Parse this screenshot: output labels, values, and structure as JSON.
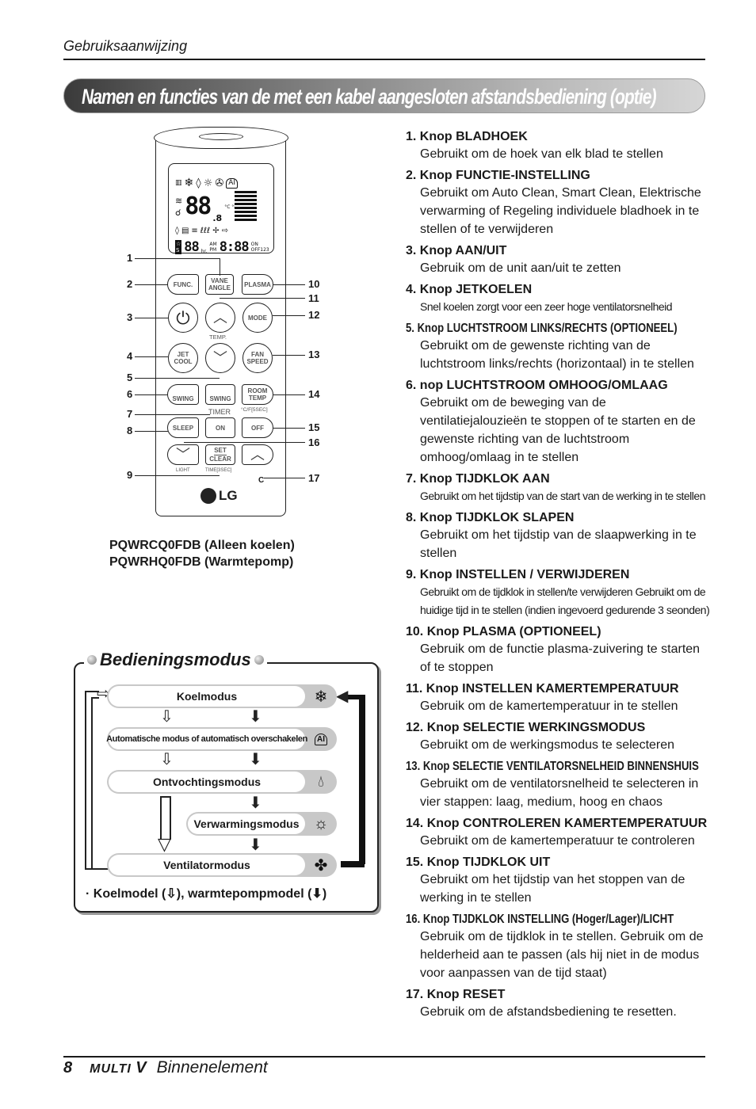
{
  "header": {
    "label": "Gebruiksaanwijzing",
    "title": "Namen en functies van de met een kabel aangesloten afstandsbediening (optie)"
  },
  "remote": {
    "lcd": {
      "icons_row1": [
        "signal-icon",
        "snowflake-icon",
        "drop-icon",
        "sun-icon",
        "fan-icon",
        "ai-icon"
      ],
      "big_digits": "88",
      "small_digit": ".8",
      "units": "°C °F",
      "timer_digits": "88",
      "timer_unit": "hr.",
      "am": "AM",
      "pm": "PM",
      "clock": "8:88",
      "on": "ON",
      "off": "OFF123"
    },
    "buttons": {
      "func": "FUNC.",
      "vane_angle": "VANE ANGLE",
      "plasma": "PLASMA",
      "mode": "MODE",
      "temp_label": "TEMP.",
      "jet_cool": "JET COOL",
      "fan_speed": "FAN SPEED",
      "swing_h": "SWING",
      "swing_v": "SWING",
      "room_temp": "ROOM TEMP",
      "room_temp_sub": "°C/F[5SEC]",
      "timer_label": "TIMER",
      "sleep": "SLEEP",
      "on": "ON",
      "off": "OFF",
      "set": "SET",
      "clear": "CLEAR",
      "light_label": "LIGHT",
      "time_label": "TIME[3SEC]",
      "brand": "LG"
    },
    "callouts": [
      "1",
      "2",
      "3",
      "4",
      "5",
      "6",
      "7",
      "8",
      "9",
      "10",
      "11",
      "12",
      "13",
      "14",
      "15",
      "16",
      "17"
    ]
  },
  "models": {
    "line1": "PQWRCQ0FDB (Alleen koelen)",
    "line2": "PQWRHQ0FDB (Warmtepomp)"
  },
  "modes": {
    "title": "Bedieningsmodus",
    "items": [
      {
        "label": "Koelmodus",
        "icon": "snowflake-icon"
      },
      {
        "label": "Automatische modus of automatisch overschakelen",
        "icon": "ai-icon"
      },
      {
        "label": "Ontvochtingsmodus",
        "icon": "drop-icon"
      },
      {
        "label": "Verwarmingsmodus",
        "icon": "sun-icon"
      },
      {
        "label": "Ventilatormodus",
        "icon": "fan-icon"
      }
    ],
    "footer": "· Koelmodel (⇩), warmtepompmodel (⬇)"
  },
  "items": [
    {
      "title": "1. Knop BLADHOEK",
      "desc": "Gebruikt om de hoek van elk blad te stellen"
    },
    {
      "title": "2. Knop FUNCTIE-INSTELLING",
      "desc": "Gebruikt om Auto Clean, Smart Clean, Elektrische verwarming of Regeling individuele bladhoek in te stellen of te verwijderen"
    },
    {
      "title": "3. Knop AAN/UIT",
      "desc": "Gebruik om de unit aan/uit te zetten"
    },
    {
      "title": "4. Knop JETKOELEN",
      "desc": "Snel koelen zorgt voor een zeer hoge ventilatorsnelheid"
    },
    {
      "title": "5. Knop LUCHTSTROOM LINKS/RECHTS (OPTIONEEL)",
      "desc": "Gebruikt om de gewenste richting van de luchtstroom links/rechts (horizontaal) in te stellen"
    },
    {
      "title": "6. nop LUCHTSTROOM OMHOOG/OMLAAG",
      "desc": "Gebruikt om de beweging van de ventilatiejalouzieën te stoppen of te starten en de gewenste richting van de luchtstroom omhoog/omlaag in te stellen"
    },
    {
      "title": "7. Knop TIJDKLOK AAN",
      "desc": "Gebruikt om het tijdstip van de start van de werking in te stellen"
    },
    {
      "title": "8. Knop TIJDKLOK SLAPEN",
      "desc": "Gebruikt om het tijdstip van de slaapwerking in te stellen"
    },
    {
      "title": "9. Knop INSTELLEN / VERWIJDEREN",
      "desc": "Gebruikt om de tijdklok in stellen/te verwijderen Gebruikt om de huidige tijd in te stellen (indien ingevoerd gedurende 3 seonden)"
    },
    {
      "title": "10. Knop PLASMA (OPTIONEEL)",
      "desc": "Gebruik om de functie plasma-zuivering te starten of te stoppen"
    },
    {
      "title": "11. Knop INSTELLEN KAMERTEMPERATUUR",
      "desc": "Gebruik om de kamertemperatuur in te stellen"
    },
    {
      "title": "12. Knop SELECTIE WERKINGSMODUS",
      "desc": "Gebruikt om de werkingsmodus te selecteren"
    },
    {
      "title": "13. Knop SELECTIE VENTILATORSNELHEID BINNENSHUIS",
      "desc": "Gebruikt om de ventilatorsnelheid te selecteren in vier stappen: laag, medium, hoog en chaos"
    },
    {
      "title": "14. Knop CONTROLEREN KAMERTEMPERATUUR",
      "desc": "Gebruikt om de kamertemperatuur te controleren"
    },
    {
      "title": "15. Knop TIJDKLOK UIT",
      "desc": "Gebruikt om het tijdstip van het stoppen van de werking in te stellen"
    },
    {
      "title": "16. Knop TIJDKLOK INSTELLING (Hoger/Lager)/LICHT",
      "desc": "Gebruik om de tijdklok in te stellen. Gebruik om de helderheid aan te passen (als hij niet in de modus voor aanpassen van de tijd staat)"
    },
    {
      "title": "17. Knop RESET",
      "desc": "Gebruik om de afstandsbediening te resetten."
    }
  ],
  "footer": {
    "page": "8",
    "brand": "MULTI",
    "brand_v": "V",
    "section": "Binnenelement"
  }
}
